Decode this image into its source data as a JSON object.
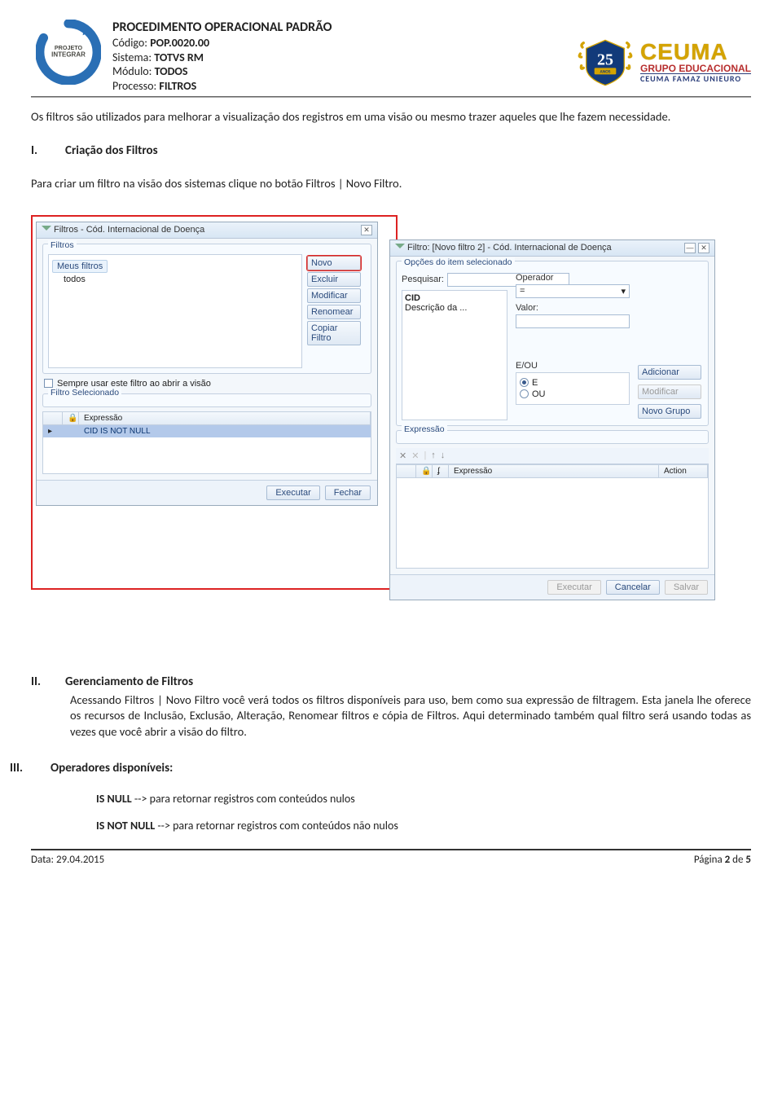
{
  "header": {
    "title": "PROCEDIMENTO OPERACIONAL PADRÃO",
    "codigo_label": "Código: ",
    "codigo": "POP.0020.00",
    "sistema_label": "Sistema: ",
    "sistema": "TOTVS RM",
    "modulo_label": "Módulo: ",
    "modulo": "TODOS",
    "processo_label": "Processo: ",
    "processo": "FILTROS",
    "integrar_l1": "PROJETO",
    "integrar_l2": "INTEGRAR",
    "badge_num": "25",
    "badge_anos": "ANOS",
    "ceuma_l1": "CEUMA",
    "ceuma_l2": "GRUPO EDUCACIONAL",
    "ceuma_l3": "CEUMA FAMAZ UNIEURO"
  },
  "intro": "Os filtros são utilizados para melhorar a visualização dos registros em uma visão ou mesmo trazer aqueles que lhe fazem necessidade.",
  "sec1": {
    "roman": "I.",
    "title": "Criação dos Filtros",
    "body": "Para criar um filtro na visão dos sistemas clique no botão Filtros | Novo Filtro."
  },
  "dlg1": {
    "title": "Filtros - Cód. Internacional de Doença",
    "grp_filtros": "Filtros",
    "meus_filtros": "Meus filtros",
    "todos": "todos",
    "btn_novo": "Novo",
    "btn_excluir": "Excluir",
    "btn_modificar": "Modificar",
    "btn_renomear": "Renomear",
    "btn_copiar": "Copiar Filtro",
    "chk_sempre": "Sempre usar este filtro ao abrir a visão",
    "grp_sel": "Filtro Selecionado",
    "col_expr": "Expressão",
    "row_expr": "CID IS NOT NULL",
    "btn_exec": "Executar",
    "btn_fechar": "Fechar"
  },
  "dlg2": {
    "title": "Filtro: [Novo filtro 2] - Cód. Internacional de Doença",
    "grp_opcoes": "Opções do item selecionado",
    "pesquisar": "Pesquisar:",
    "f_cid": "CID",
    "f_desc": "Descrição da ...",
    "operador": "Operador",
    "op_eq": "=",
    "valor": "Valor:",
    "eou": "E/OU",
    "r_e": "E",
    "r_ou": "OU",
    "btn_adic": "Adicionar",
    "btn_mod": "Modificar",
    "btn_ngrp": "Novo Grupo",
    "grp_expr": "Expressão",
    "col_expr": "Expressão",
    "col_action": "Action",
    "btn_exec": "Executar",
    "btn_cancel": "Cancelar",
    "btn_salvar": "Salvar"
  },
  "sec2": {
    "roman": "II.",
    "title": "Gerenciamento de Filtros",
    "body": "Acessando Filtros | Novo Filtro você verá todos os filtros disponíveis para uso, bem como sua expressão de filtragem. Esta janela lhe oferece os recursos de Inclusão, Exclusão, Alteração, Renomear filtros e cópia de Filtros. Aqui determinado também qual filtro será usando todas as vezes que você abrir a visão do filtro."
  },
  "sec3": {
    "roman": "III.",
    "title": "Operadores disponíveis:",
    "op1_b": "IS NULL",
    "op1_t": " --> para retornar registros com conteúdos nulos",
    "op2_b": "IS NOT NULL",
    "op2_t": " --> para retornar registros com conteúdos não nulos"
  },
  "footer": {
    "data_label": "Data: ",
    "data": "29.04.2015",
    "pagina_pre": "Página ",
    "pagina_n": "2",
    "pagina_mid": " de ",
    "pagina_total": "5"
  }
}
